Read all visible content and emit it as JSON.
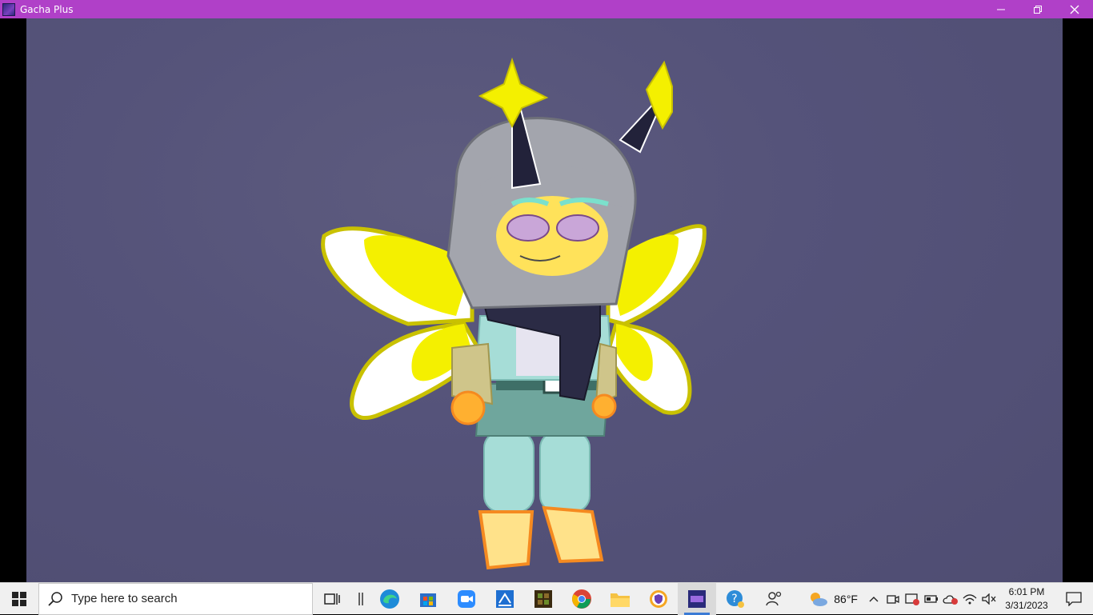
{
  "window": {
    "title": "Gacha Plus",
    "controls": {
      "minimize": "minimize-icon",
      "restore": "restore-icon",
      "close": "close-icon"
    }
  },
  "taskbar": {
    "search_placeholder": "Type here to search",
    "apps": [
      {
        "name": "task-view",
        "icon": "task-view-icon"
      },
      {
        "name": "divider",
        "icon": "bar-icon"
      },
      {
        "name": "edge",
        "icon": "edge-icon"
      },
      {
        "name": "store",
        "icon": "store-icon"
      },
      {
        "name": "zoom",
        "icon": "zoom-icon"
      },
      {
        "name": "sticky",
        "icon": "pen-app-icon"
      },
      {
        "name": "minecraft",
        "icon": "minecraft-icon"
      },
      {
        "name": "chrome",
        "icon": "chrome-icon"
      },
      {
        "name": "explorer",
        "icon": "folder-icon"
      },
      {
        "name": "vpn",
        "icon": "shield-app-icon"
      },
      {
        "name": "gacha",
        "icon": "gacha-plus-icon",
        "active": true
      },
      {
        "name": "help",
        "icon": "help-icon"
      },
      {
        "name": "people",
        "icon": "people-icon"
      }
    ],
    "weather": "86°F",
    "clock": {
      "time": "6:01 PM",
      "date": "3/31/2023"
    }
  },
  "colors": {
    "titlebar": "#b040c8",
    "canvas": "#55537a",
    "wing_yellow": "#f4f000",
    "accent_blue": "#3a7bd5"
  }
}
